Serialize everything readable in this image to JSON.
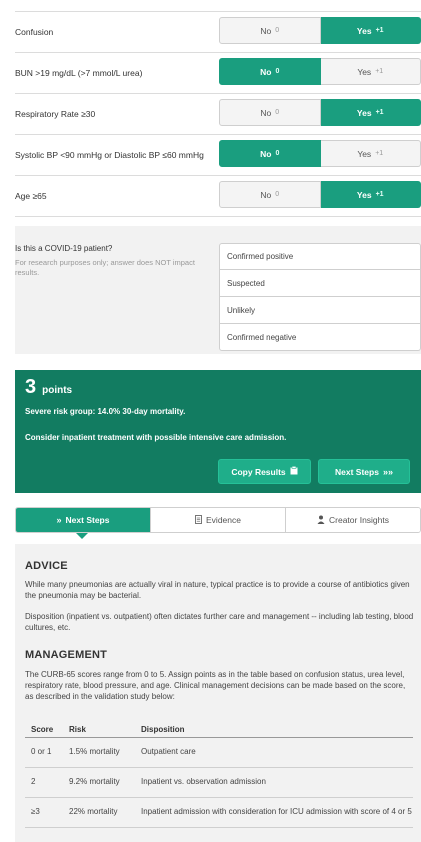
{
  "criteria": [
    {
      "label": "Confusion",
      "no_label": "No",
      "no_points": "0",
      "yes_label": "Yes",
      "yes_points": "+1",
      "selected": "yes"
    },
    {
      "label": "BUN >19 mg/dL (>7 mmol/L urea)",
      "no_label": "No",
      "no_points": "0",
      "yes_label": "Yes",
      "yes_points": "+1",
      "selected": "no"
    },
    {
      "label": "Respiratory Rate ≥30",
      "no_label": "No",
      "no_points": "0",
      "yes_label": "Yes",
      "yes_points": "+1",
      "selected": "yes"
    },
    {
      "label": "Systolic BP <90 mmHg or Diastolic BP ≤60 mmHg",
      "no_label": "No",
      "no_points": "0",
      "yes_label": "Yes",
      "yes_points": "+1",
      "selected": "no"
    },
    {
      "label": "Age ≥65",
      "no_label": "No",
      "no_points": "0",
      "yes_label": "Yes",
      "yes_points": "+1",
      "selected": "yes"
    }
  ],
  "covid": {
    "question": "Is this a COVID-19 patient?",
    "note": "For research purposes only; answer does NOT impact results.",
    "options": [
      "Confirmed positive",
      "Suspected",
      "Unlikely",
      "Confirmed negative"
    ]
  },
  "result": {
    "score": "3",
    "unit": "points",
    "line1": "Severe risk group: 14.0% 30-day mortality.",
    "line2": "Consider inpatient treatment with possible intensive care admission.",
    "copy_label": "Copy Results",
    "next_label": "Next Steps",
    "copy_icon": "clipboard-icon",
    "next_icon": "chevrons-right-icon"
  },
  "tabs": [
    {
      "label": "Next Steps",
      "icon": "chevrons-right-icon",
      "glyph": "»",
      "active": true
    },
    {
      "label": "Evidence",
      "icon": "document-icon",
      "glyph": "🗎",
      "active": false
    },
    {
      "label": "Creator Insights",
      "icon": "person-icon",
      "glyph": "👤",
      "active": false
    }
  ],
  "content": {
    "advice_title": "ADVICE",
    "advice_p1": "While many pneumonias are actually viral in nature, typical practice is to provide a course of antibiotics given the pneumonia may be bacterial.",
    "advice_p2": "Disposition (inpatient vs. outpatient) often dictates further care and management -- including lab testing, blood cultures, etc.",
    "management_title": "MANAGEMENT",
    "management_p": "The CURB-65 scores range from 0 to 5. Assign points as in the table based on confusion status, urea level, respiratory rate, blood pressure, and age. Clinical management decisions can be made based on the score, as described in the validation study below:",
    "table": {
      "headers": [
        "Score",
        "Risk",
        "Disposition"
      ],
      "rows": [
        [
          "0 or 1",
          "1.5% mortality",
          "Outpatient care"
        ],
        [
          "2",
          "9.2% mortality",
          "Inpatient vs. observation admission"
        ],
        [
          "≥3",
          "22% mortality",
          "Inpatient admission with consideration for ICU admission with score of 4 or 5"
        ]
      ]
    }
  },
  "colors": {
    "accent": "#1a9e7f",
    "result_bg": "#127c61",
    "panel_bg": "#f2f2f2"
  }
}
